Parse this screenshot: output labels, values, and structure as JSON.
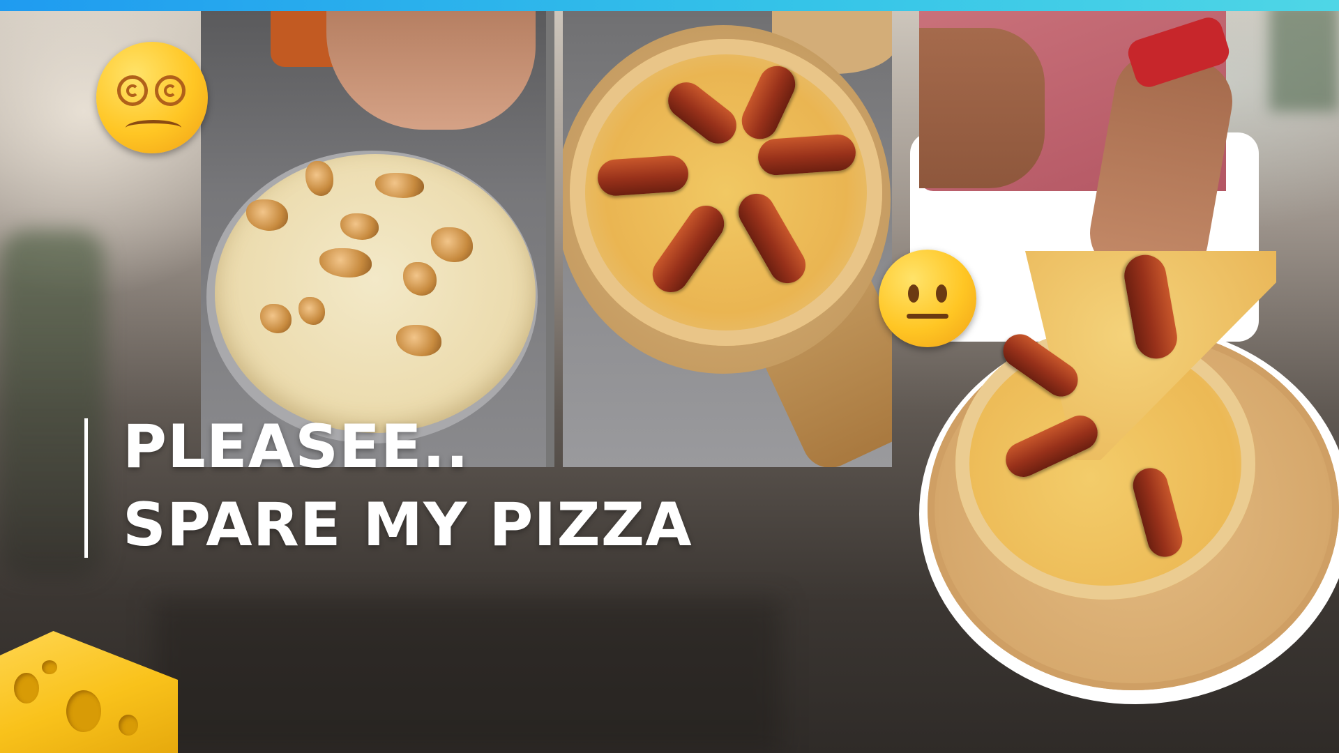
{
  "headline": {
    "line1": "PLEASEE..",
    "line2": "SPARE MY PIZZA"
  },
  "colors": {
    "top_bar": "#1f9bf0",
    "headline_text": "#ffffff",
    "accent_emoji": "#ffc624",
    "cheese": "#f9c21b"
  },
  "icons": {
    "dizzy": "dizzy-face-emoji",
    "neutral": "neutral-face-emoji",
    "cheese": "cheese-wedge"
  }
}
